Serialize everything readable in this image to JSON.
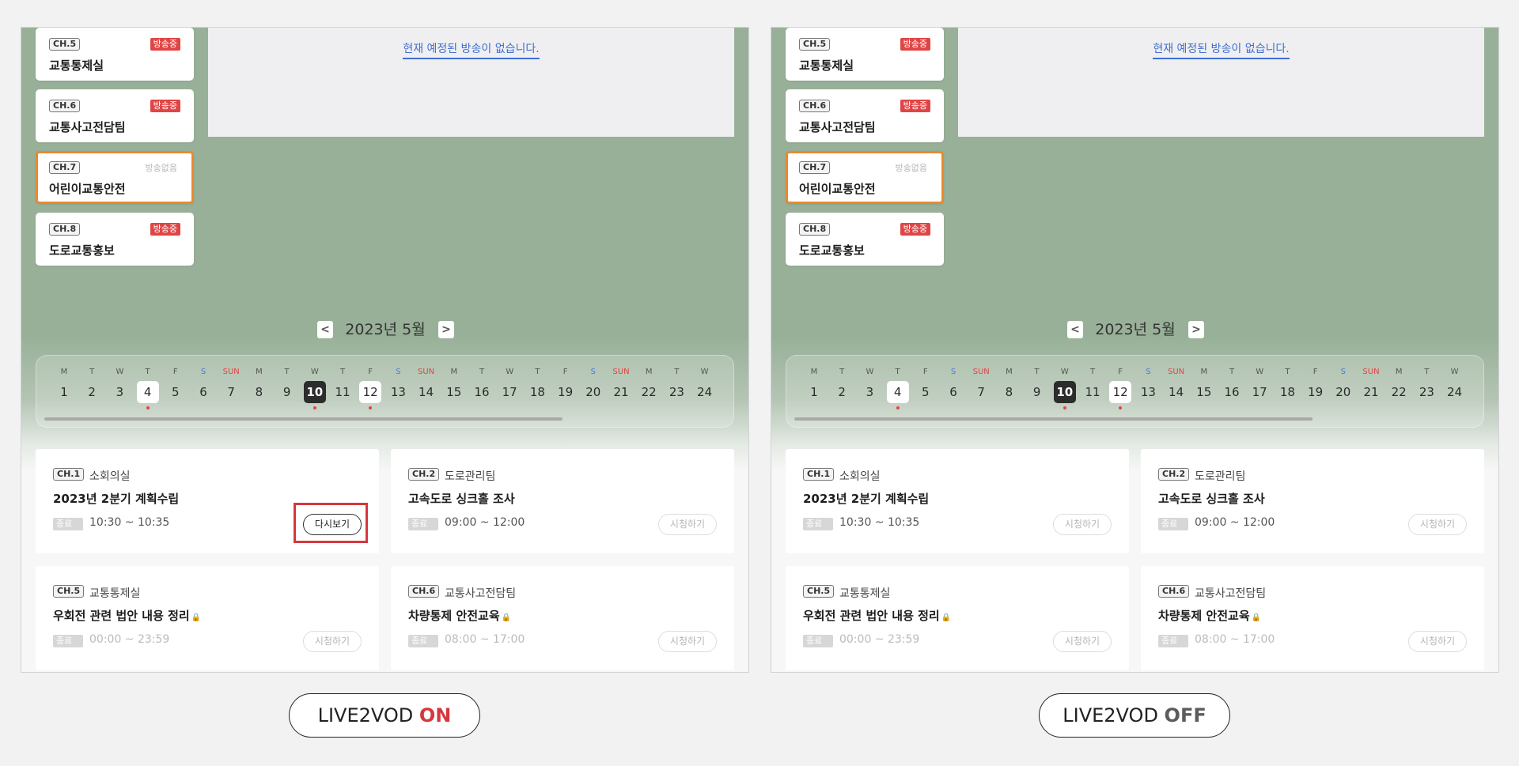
{
  "panels": [
    {
      "id": "left",
      "channels": [
        {
          "tag": "CH.5",
          "name": "교통통제실",
          "status": "방송중",
          "active": false
        },
        {
          "tag": "CH.6",
          "name": "교통사고전담팀",
          "status": "방송중",
          "active": false
        },
        {
          "tag": "CH.7",
          "name": "어린이교통안전",
          "status": "방송없음",
          "active": true
        },
        {
          "tag": "CH.8",
          "name": "도로교통홍보",
          "status": "방송중",
          "active": false
        }
      ],
      "notice": "현재 예정된 방송이 없습니다.",
      "month": "2023년 5월",
      "programs": [
        {
          "ch": "CH.1",
          "team": "소회의실",
          "title": "2023년 2분기 계획수립",
          "status": "종료",
          "time": "10:30 ~ 10:35",
          "button": "다시보기",
          "replay": true,
          "locked": false
        },
        {
          "ch": "CH.2",
          "team": "도로관리팀",
          "title": "고속도로 싱크홀 조사",
          "status": "종료",
          "time": "09:00 ~ 12:00",
          "button": "시청하기",
          "replay": false,
          "locked": false
        },
        {
          "ch": "CH.5",
          "team": "교통통제실",
          "title": "우회전 관련 법안 내용 정리",
          "status": "종료",
          "time": "00:00 ~ 23:59",
          "button": "시청하기",
          "replay": false,
          "locked": true
        },
        {
          "ch": "CH.6",
          "team": "교통사고전담팀",
          "title": "차량통제 안전교육",
          "status": "종료",
          "time": "08:00 ~ 17:00",
          "button": "시청하기",
          "replay": false,
          "locked": true
        }
      ]
    },
    {
      "id": "right",
      "channels": [
        {
          "tag": "CH.5",
          "name": "교통통제실",
          "status": "방송중",
          "active": false
        },
        {
          "tag": "CH.6",
          "name": "교통사고전담팀",
          "status": "방송중",
          "active": false
        },
        {
          "tag": "CH.7",
          "name": "어린이교통안전",
          "status": "방송없음",
          "active": true
        },
        {
          "tag": "CH.8",
          "name": "도로교통홍보",
          "status": "방송중",
          "active": false
        }
      ],
      "notice": "현재 예정된 방송이 없습니다.",
      "month": "2023년 5월",
      "programs": [
        {
          "ch": "CH.1",
          "team": "소회의실",
          "title": "2023년 2분기 계획수립",
          "status": "종료",
          "time": "10:30 ~ 10:35",
          "button": "시청하기",
          "replay": false,
          "locked": false
        },
        {
          "ch": "CH.2",
          "team": "도로관리팀",
          "title": "고속도로 싱크홀 조사",
          "status": "종료",
          "time": "09:00 ~ 12:00",
          "button": "시청하기",
          "replay": false,
          "locked": false
        },
        {
          "ch": "CH.5",
          "team": "교통통제실",
          "title": "우회전 관련 법안 내용 정리",
          "status": "종료",
          "time": "00:00 ~ 23:59",
          "button": "시청하기",
          "replay": false,
          "locked": true
        },
        {
          "ch": "CH.6",
          "team": "교통사고전담팀",
          "title": "차량통제 안전교육",
          "status": "종료",
          "time": "08:00 ~ 17:00",
          "button": "시청하기",
          "replay": false,
          "locked": true
        }
      ]
    }
  ],
  "calendar": {
    "days": [
      {
        "d": "M",
        "n": "1"
      },
      {
        "d": "T",
        "n": "2"
      },
      {
        "d": "W",
        "n": "3"
      },
      {
        "d": "T",
        "n": "4",
        "mark": true,
        "dot": true
      },
      {
        "d": "F",
        "n": "5"
      },
      {
        "d": "S",
        "n": "6",
        "kind": "sat"
      },
      {
        "d": "SUN",
        "n": "7",
        "kind": "sun"
      },
      {
        "d": "M",
        "n": "8"
      },
      {
        "d": "T",
        "n": "9"
      },
      {
        "d": "W",
        "n": "10",
        "today": true,
        "dot": true
      },
      {
        "d": "T",
        "n": "11"
      },
      {
        "d": "F",
        "n": "12",
        "mark": true,
        "dot": true
      },
      {
        "d": "S",
        "n": "13",
        "kind": "sat"
      },
      {
        "d": "SUN",
        "n": "14",
        "kind": "sun"
      },
      {
        "d": "M",
        "n": "15"
      },
      {
        "d": "T",
        "n": "16"
      },
      {
        "d": "W",
        "n": "17"
      },
      {
        "d": "T",
        "n": "18"
      },
      {
        "d": "F",
        "n": "19"
      },
      {
        "d": "S",
        "n": "20",
        "kind": "sat"
      },
      {
        "d": "SUN",
        "n": "21",
        "kind": "sun"
      },
      {
        "d": "M",
        "n": "22"
      },
      {
        "d": "T",
        "n": "23"
      },
      {
        "d": "W",
        "n": "24"
      }
    ]
  },
  "labels": {
    "left_prefix": "LIVE2VOD ",
    "left_state": "ON",
    "right_prefix": "LIVE2VOD ",
    "right_state": "OFF"
  },
  "nav": {
    "prev": "<",
    "next": ">"
  },
  "icons": {
    "lock": "lock-icon",
    "prev": "chevron-left-icon",
    "next": "chevron-right-icon"
  },
  "colors": {
    "accent_red": "#d6373d",
    "active_border": "#e98a2c",
    "live_badge": "#e04545",
    "link_blue": "#3f6fd0"
  }
}
